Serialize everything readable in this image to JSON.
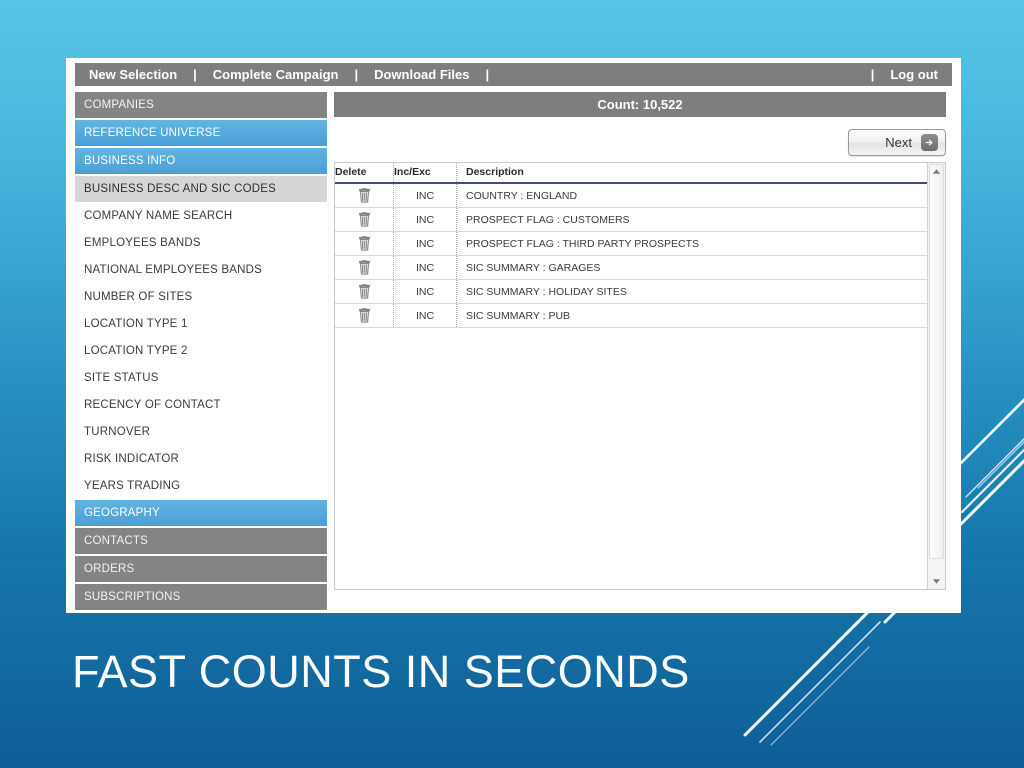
{
  "slide": {
    "title": "FAST COUNTS IN SECONDS",
    "background_top_color": "#56c6e6",
    "background_bottom_color": "#0e5f97"
  },
  "toolbar": {
    "items": [
      {
        "label": "New Selection"
      },
      {
        "label": "Complete Campaign"
      },
      {
        "label": "Download Files"
      }
    ],
    "separator": "|",
    "logout_label": "Log out"
  },
  "sidebar": {
    "items": [
      {
        "label": "COMPANIES",
        "style": "grey"
      },
      {
        "label": "REFERENCE UNIVERSE",
        "style": "blue"
      },
      {
        "label": "BUSINESS INFO",
        "style": "blue"
      },
      {
        "label": "BUSINESS DESC AND SIC CODES",
        "style": "leaf-selected"
      },
      {
        "label": "COMPANY NAME SEARCH",
        "style": "leaf"
      },
      {
        "label": "EMPLOYEES BANDS",
        "style": "leaf"
      },
      {
        "label": "NATIONAL EMPLOYEES BANDS",
        "style": "leaf"
      },
      {
        "label": "NUMBER OF SITES",
        "style": "leaf"
      },
      {
        "label": "LOCATION TYPE 1",
        "style": "leaf"
      },
      {
        "label": "LOCATION TYPE 2",
        "style": "leaf"
      },
      {
        "label": "SITE STATUS",
        "style": "leaf"
      },
      {
        "label": "RECENCY OF CONTACT",
        "style": "leaf"
      },
      {
        "label": "TURNOVER",
        "style": "leaf"
      },
      {
        "label": "RISK INDICATOR",
        "style": "leaf"
      },
      {
        "label": "YEARS TRADING",
        "style": "leaf"
      },
      {
        "label": "GEOGRAPHY",
        "style": "blue"
      },
      {
        "label": "CONTACTS",
        "style": "grey"
      },
      {
        "label": "ORDERS",
        "style": "grey"
      },
      {
        "label": "SUBSCRIPTIONS",
        "style": "grey"
      }
    ],
    "accent_blue": "#4a9fd4",
    "accent_grey": "#858482"
  },
  "main": {
    "count_label": "Count: 10,522",
    "next_button_label": "Next",
    "table": {
      "columns": [
        "Delete",
        "Inc/Exc",
        "Description"
      ],
      "rows": [
        {
          "delete_icon": "trash-icon",
          "incexc": "INC",
          "description": "COUNTRY : ENGLAND"
        },
        {
          "delete_icon": "trash-icon",
          "incexc": "INC",
          "description": "PROSPECT FLAG : CUSTOMERS"
        },
        {
          "delete_icon": "trash-icon",
          "incexc": "INC",
          "description": "PROSPECT FLAG : THIRD PARTY PROSPECTS"
        },
        {
          "delete_icon": "trash-icon",
          "incexc": "INC",
          "description": "SIC SUMMARY : GARAGES"
        },
        {
          "delete_icon": "trash-icon",
          "incexc": "INC",
          "description": "SIC SUMMARY : HOLIDAY SITES"
        },
        {
          "delete_icon": "trash-icon",
          "incexc": "INC",
          "description": "SIC SUMMARY : PUB"
        }
      ]
    },
    "scrollbar": {
      "up_icon": "scroll-up-arrow-icon",
      "down_icon": "scroll-down-arrow-icon"
    }
  }
}
